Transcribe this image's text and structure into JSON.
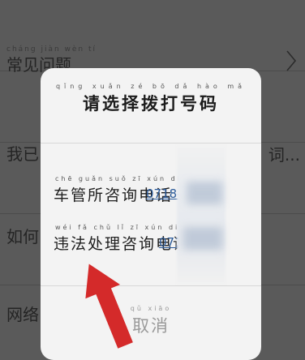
{
  "background": {
    "rows": [
      {
        "pinyin": "cháng jiàn wèn tí",
        "label": "常见问题"
      },
      {
        "label": "我已..."
      },
      {
        "label": "如何..."
      },
      {
        "label": "网络..."
      }
    ],
    "right_fragment": "词..."
  },
  "modal": {
    "title_pinyin": "qǐng xuǎn zé bō dǎ hào mǎ",
    "title": "请选择拨打号码",
    "options": [
      {
        "pinyin": "chē guǎn suǒ zī xún diàn huà",
        "label": "车管所咨询电话",
        "phone": "0718-8"
      },
      {
        "pinyin": "wéi fǎ chǔ lǐ zī xún diàn huà",
        "label": "违法处理咨询电话",
        "phone": "0718"
      }
    ],
    "cancel_pinyin": "qǔ xiāo",
    "cancel": "取消"
  }
}
